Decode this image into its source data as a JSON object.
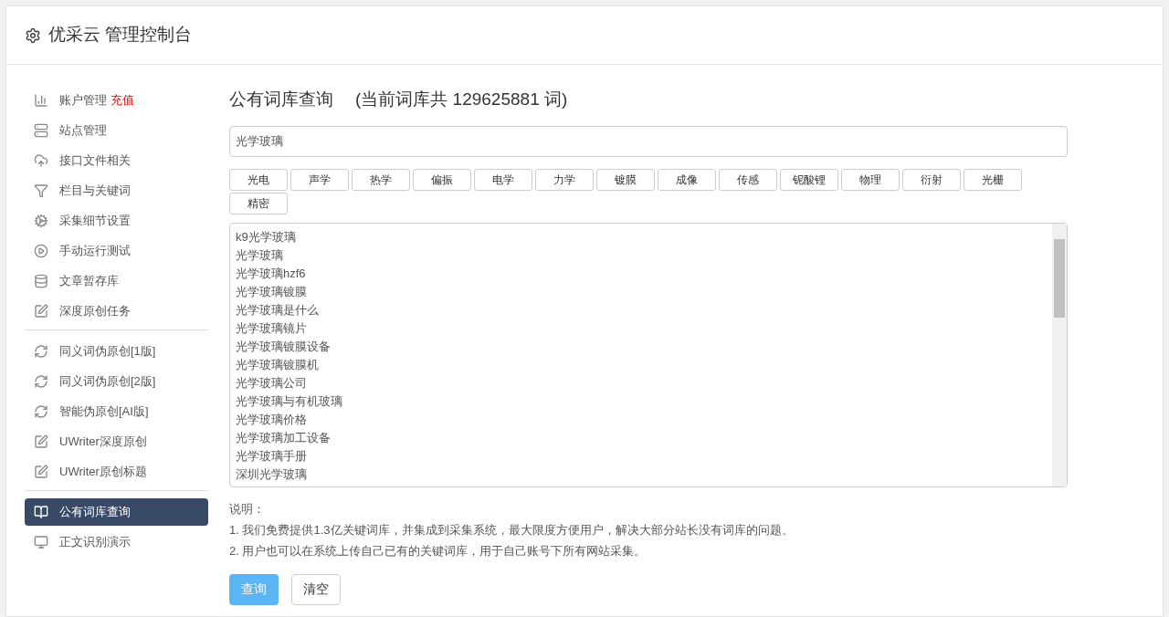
{
  "header": {
    "title": "优采云 管理控制台"
  },
  "sidebar": {
    "groups": [
      [
        {
          "label": "账户管理",
          "badge": "充值",
          "selected": false
        },
        {
          "label": "站点管理",
          "selected": false
        },
        {
          "label": "接口文件相关",
          "selected": false
        },
        {
          "label": "栏目与关键词",
          "selected": false
        },
        {
          "label": "采集细节设置",
          "selected": false
        },
        {
          "label": "手动运行测试",
          "selected": false
        },
        {
          "label": "文章暂存库",
          "selected": false
        },
        {
          "label": "深度原创任务",
          "selected": false
        }
      ],
      [
        {
          "label": "同义词伪原创[1版]",
          "selected": false
        },
        {
          "label": "同义词伪原创[2版]",
          "selected": false
        },
        {
          "label": "智能伪原创[AI版]",
          "selected": false
        },
        {
          "label": "UWriter深度原创",
          "selected": false
        },
        {
          "label": "UWriter原创标题",
          "selected": false
        }
      ],
      [
        {
          "label": "公有词库查询",
          "selected": true
        },
        {
          "label": "正文识别演示",
          "selected": false
        }
      ]
    ]
  },
  "main": {
    "title": "公有词库查询",
    "count": "(当前词库共 129625881 词)",
    "search": {
      "value": "光学玻璃"
    },
    "tags": [
      "光电",
      "声学",
      "热学",
      "偏振",
      "电学",
      "力学",
      "镀膜",
      "成像",
      "传感",
      "铌酸锂",
      "物理",
      "衍射",
      "光栅",
      "精密"
    ],
    "results": [
      "k9光学玻璃",
      "光学玻璃",
      "光学玻璃hzf6",
      "光学玻璃镀膜",
      "光学玻璃是什么",
      "光学玻璃镜片",
      "光学玻璃镀膜设备",
      "光学玻璃镀膜机",
      "光学玻璃公司",
      "光学玻璃与有机玻璃",
      "光学玻璃价格",
      "光学玻璃加工设备",
      "光学玻璃手册",
      "深圳光学玻璃"
    ],
    "notes_title": "说明：",
    "notes": [
      "1. 我们免费提供1.3亿关键词库，并集成到采集系统，最大限度方便用户，解决大部分站长没有词库的问题。",
      "2. 用户也可以在系统上传自己已有的关键词库，用于自己账号下所有网站采集。"
    ],
    "buttons": [
      {
        "label": "查询",
        "kind": "primary"
      },
      {
        "label": "清空",
        "kind": "default"
      }
    ]
  }
}
